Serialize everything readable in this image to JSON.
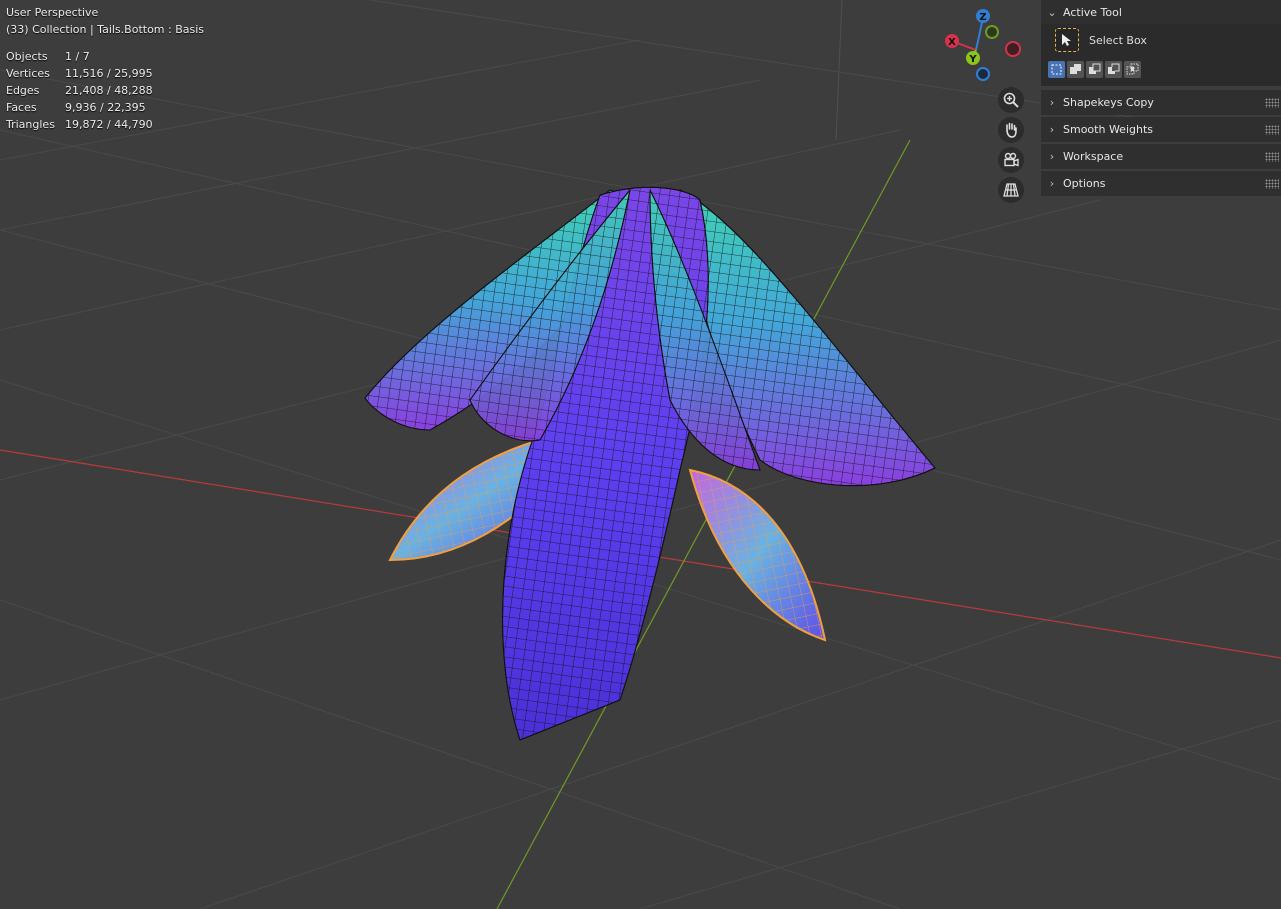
{
  "viewport": {
    "view_name": "User Perspective",
    "context": "(33) Collection | Tails.Bottom : Basis"
  },
  "stats": [
    {
      "label": "Objects",
      "value": "1 / 7"
    },
    {
      "label": "Vertices",
      "value": "11,516 / 25,995"
    },
    {
      "label": "Edges",
      "value": "21,408 / 48,288"
    },
    {
      "label": "Faces",
      "value": "9,936 / 22,395"
    },
    {
      "label": "Triangles",
      "value": "19,872 / 44,790"
    }
  ],
  "gizmo": {
    "axes": [
      {
        "label": "Z",
        "color": "#2f7fd4"
      },
      {
        "label": "X",
        "color": "#d6324b"
      },
      {
        "label": "Y",
        "color": "#8ac41c"
      }
    ]
  },
  "nav_buttons": [
    {
      "icon": "zoom-icon"
    },
    {
      "icon": "hand-pan-icon"
    },
    {
      "icon": "camera-icon"
    },
    {
      "icon": "grid-perspective-icon"
    }
  ],
  "sidebar": {
    "active_tool": {
      "title": "Active Tool",
      "tool_label": "Select Box",
      "modes": [
        "set",
        "extend",
        "subtract",
        "invert",
        "intersect"
      ]
    },
    "panels": [
      {
        "label": "Shapekeys Copy"
      },
      {
        "label": "Smooth Weights"
      },
      {
        "label": "Workspace"
      },
      {
        "label": "Options"
      }
    ]
  },
  "colors": {
    "background": "#3d3d3d",
    "selection_outline": "#f0a040",
    "x_axis_line": "#b83b3b",
    "y_axis_line": "#6f9a25"
  }
}
